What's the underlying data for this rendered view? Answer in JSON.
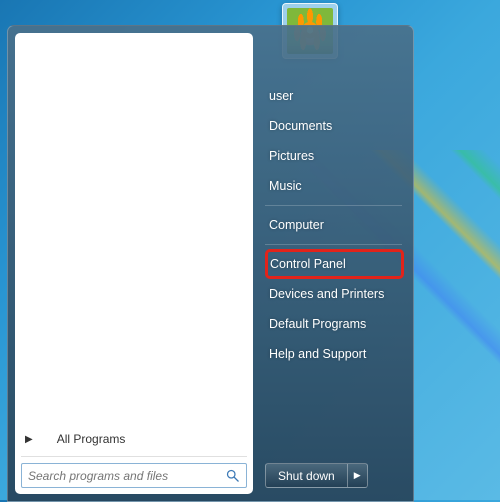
{
  "user_tile": {
    "alt": "flower-avatar"
  },
  "left": {
    "all_programs": "All Programs",
    "search_placeholder": "Search programs and files"
  },
  "right": {
    "items": [
      {
        "label": "user"
      },
      {
        "label": "Documents"
      },
      {
        "label": "Pictures"
      },
      {
        "label": "Music"
      }
    ],
    "items2": [
      {
        "label": "Computer"
      }
    ],
    "items3": [
      {
        "label": "Control Panel",
        "highlighted": true
      },
      {
        "label": "Devices and Printers"
      },
      {
        "label": "Default Programs"
      },
      {
        "label": "Help and Support"
      }
    ]
  },
  "shutdown": {
    "label": "Shut down"
  },
  "colors": {
    "highlight": "#e2231a"
  }
}
